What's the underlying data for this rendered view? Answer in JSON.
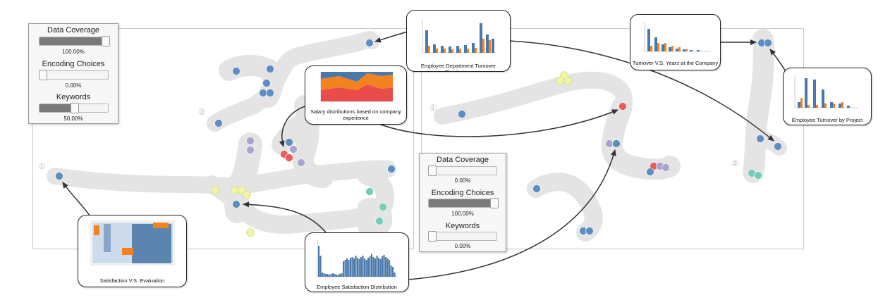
{
  "left_panel": {
    "label_1": "①",
    "label_2": "②",
    "control_box": {
      "sliders": [
        {
          "title": "Data Coverage",
          "value_text": "100.00%",
          "fraction": 1.0
        },
        {
          "title": "Encoding Choices",
          "value_text": "0.00%",
          "fraction": 0.0
        },
        {
          "title": "Keywords",
          "value_text": "50.00%",
          "fraction": 0.5
        }
      ]
    }
  },
  "right_panel": {
    "label_1": "①",
    "label_2": "②",
    "control_box": {
      "sliders": [
        {
          "title": "Data Coverage",
          "value_text": "0.00%",
          "fraction": 0.0
        },
        {
          "title": "Encoding Choices",
          "value_text": "100.00%",
          "fraction": 1.0
        },
        {
          "title": "Keywords",
          "value_text": "0.00%",
          "fraction": 0.0
        }
      ]
    }
  },
  "callouts": {
    "department": "Employee Department Turnover Distribution",
    "years": "Turnover V.S. Years at the Company",
    "salary": "Salary distributions based on company experience",
    "project": "Employee Turnover by Project Count",
    "evaluation": "Satisfaction V.S. Evaluation",
    "satisfaction": "Employee Satisfaction Distribution"
  },
  "colors": {
    "blue": "#5b8fc4",
    "purple": "#a8a3cf",
    "yellow": "#f1f4a8",
    "red": "#ea5c57",
    "teal": "#72cdbb",
    "cluster": "#e3e3e3",
    "bar_blue": "#4a78aa",
    "bar_orange": "#f4821f"
  }
}
